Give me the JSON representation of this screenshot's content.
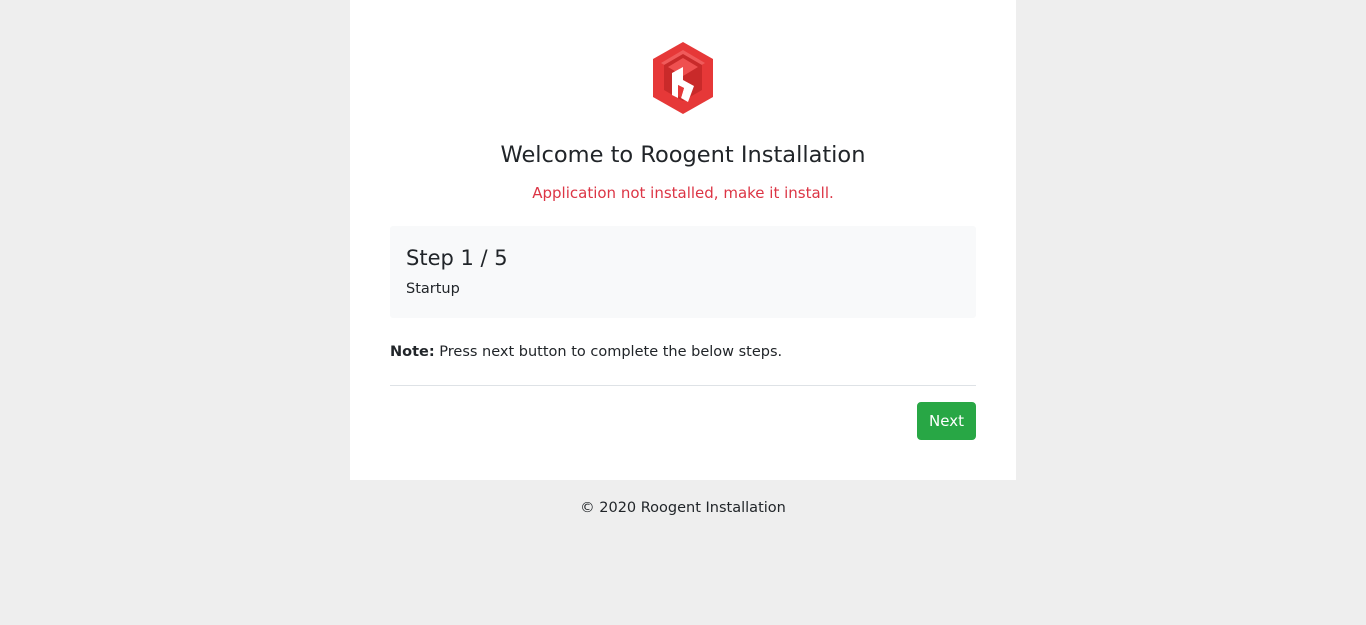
{
  "header": {
    "logo_icon": "roogent-hexagon-logo-icon",
    "title": "Welcome to Roogent Installation",
    "status_message": "Application not installed, make it install."
  },
  "step": {
    "title": "Step 1 / 5",
    "name": "Startup"
  },
  "note": {
    "label": "Note:",
    "text": " Press next button to complete the below steps."
  },
  "actions": {
    "next_label": "Next"
  },
  "footer": {
    "text": "© 2020 Roogent Installation"
  },
  "colors": {
    "page_background": "#eeeeee",
    "card_background": "#ffffff",
    "step_background": "#f8f9fa",
    "status_red": "#dc3545",
    "button_green": "#28a745",
    "logo_red": "#e63838"
  }
}
